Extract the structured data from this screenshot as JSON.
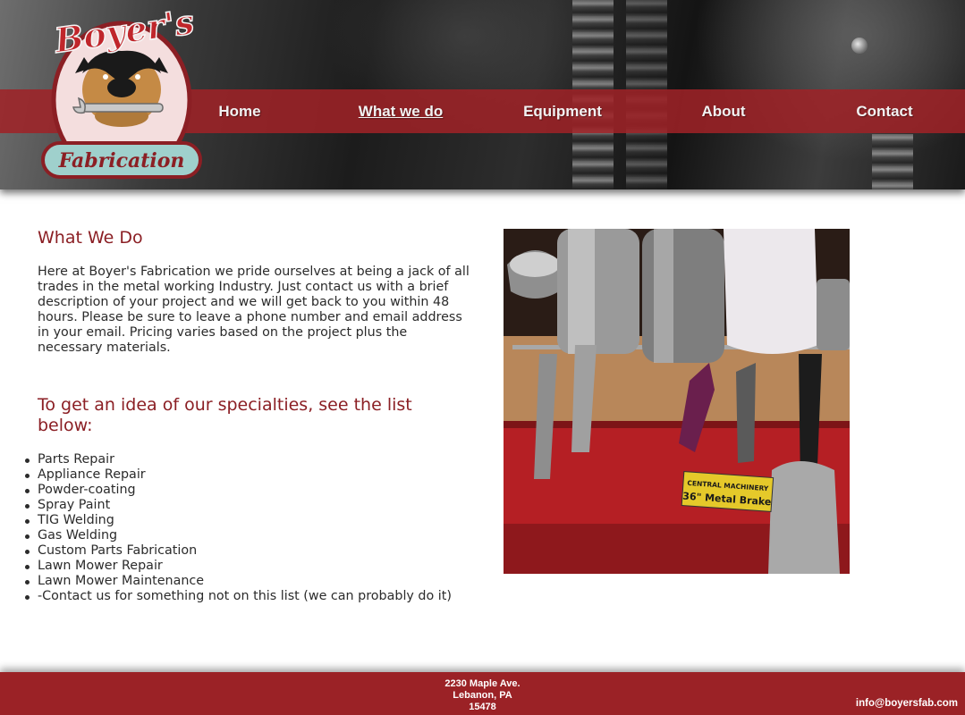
{
  "logo": {
    "top_text": "Boyer's",
    "bottom_text": "Fabrication"
  },
  "nav": {
    "home": "Home",
    "what_we_do": "What we do",
    "equipment": "Equipment",
    "about": "About",
    "contact": "Contact",
    "active": "what_we_do"
  },
  "main": {
    "heading": "What We Do",
    "intro": "Here at Boyer's Fabrication we pride ourselves at being a jack of all trades in the metal working Industry. Just contact us with a brief description of your project and we will get back to you within 48 hours. Please be sure to leave a phone number and email address in your email. Pricing varies based on the project plus the necessary materials.",
    "specialties_heading": "To get an idea of our specialties, see the list below:",
    "specialties": [
      "Parts Repair",
      "Appliance Repair",
      "Powder-coating",
      "Spray Paint",
      "TIG Welding",
      "Gas Welding",
      "Custom Parts Fabrication",
      "Lawn Mower Repair",
      "Lawn Mower Maintenance",
      "-Contact us for something not on this list (we can probably do it)"
    ]
  },
  "photo": {
    "sign_line1": "CENTRAL MACHINERY",
    "sign_line2": "36\" Metal Brake"
  },
  "footer": {
    "address_line1": "2230 Maple Ave.",
    "address_line2": "Lebanon, PA",
    "address_line3": "15478",
    "email": "info@boyersfab.com"
  },
  "colors": {
    "brand_red": "#9b2226",
    "heading_red": "#8b1f24",
    "text": "#2b2b2b"
  }
}
